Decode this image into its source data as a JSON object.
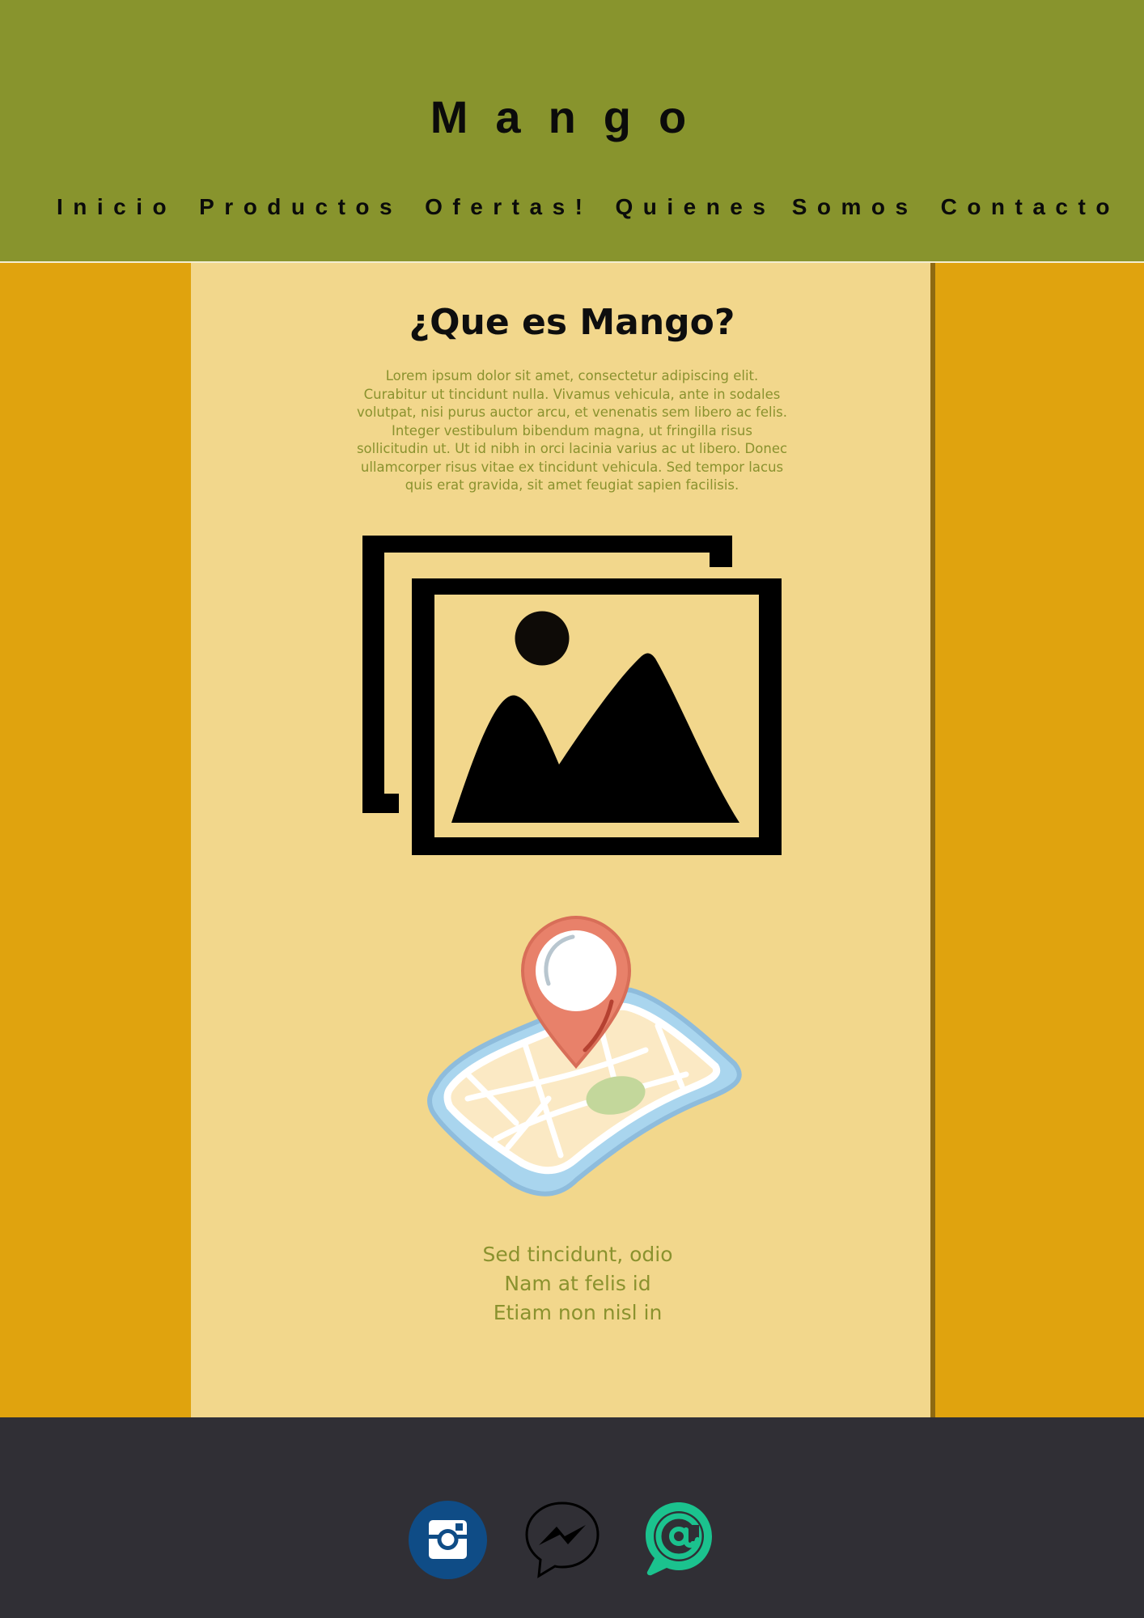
{
  "header": {
    "brand": "Mango",
    "nav": [
      "Inicio",
      "Productos",
      "Ofertas!",
      "Quienes Somos",
      "Contacto"
    ]
  },
  "main": {
    "title": "¿Que es Mango?",
    "description": "Lorem ipsum dolor sit amet, consectetur adipiscing elit. Curabitur ut tincidunt nulla. Vivamus vehicula, ante in sodales volutpat, nisi purus auctor arcu, et venenatis sem libero ac felis. Integer vestibulum bibendum magna, ut fringilla risus sollicitudin ut. Ut id nibh in orci lacinia varius ac ut libero. Donec ullamcorper risus vitae ex tincidunt vehicula. Sed tempor lacus quis erat gravida, sit amet feugiat sapien facilisis.",
    "lines": [
      "Sed tincidunt, odio",
      "Nam at felis id",
      "Etiam non nisl in"
    ]
  },
  "footer": {
    "icons": [
      "instagram-icon",
      "messenger-icon",
      "chat-at-icon"
    ]
  },
  "colors": {
    "header_bg": "#88942d",
    "side_bg": "#e0a30e",
    "content_bg": "#f2d78c",
    "text_green": "#8a922e",
    "footer_bg": "#302f35"
  }
}
